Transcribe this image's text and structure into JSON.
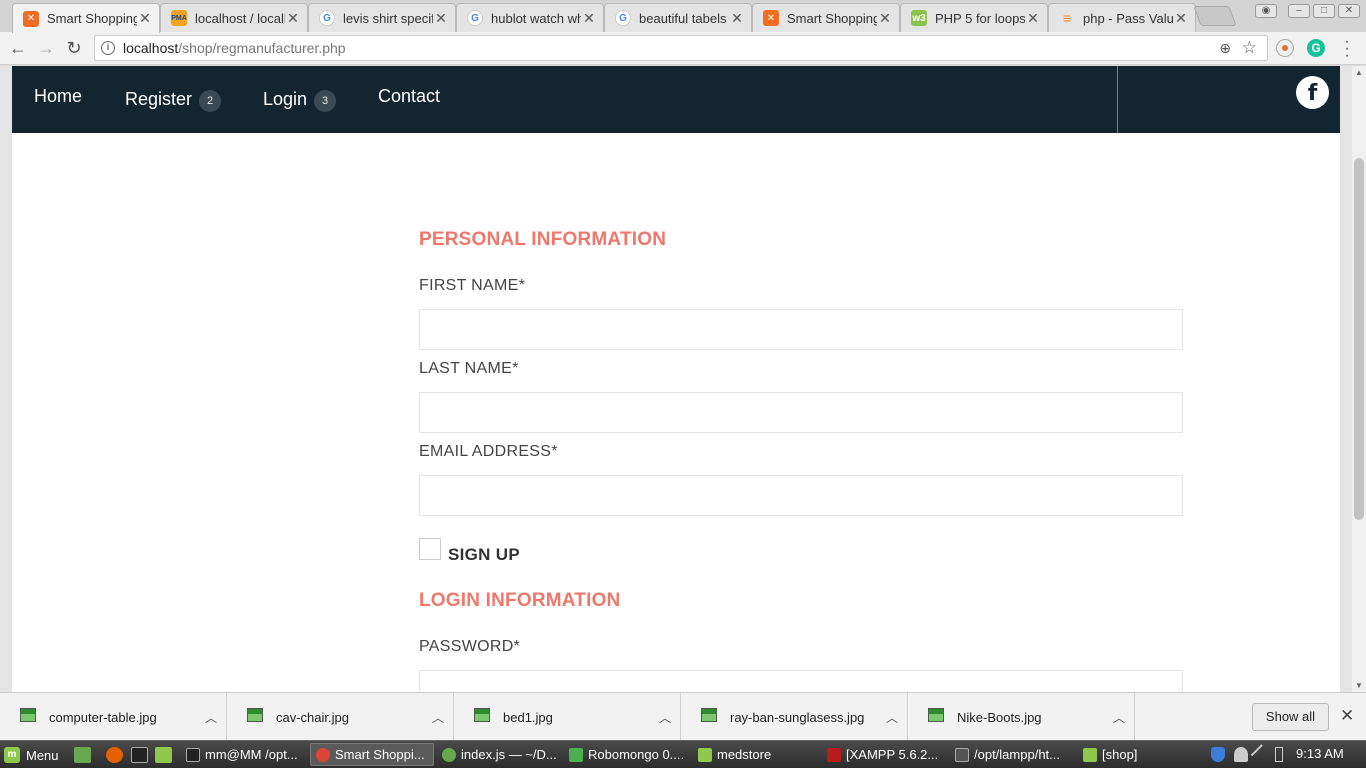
{
  "browser": {
    "tabs": [
      {
        "title": "Smart Shopping",
        "icon": "xampp-icon",
        "active": true
      },
      {
        "title": "localhost / localhost",
        "icon": "phpmyadmin-icon"
      },
      {
        "title": "levis shirt specifications",
        "icon": "google-icon"
      },
      {
        "title": "hublot watch white",
        "icon": "google-icon"
      },
      {
        "title": "beautiful tabels",
        "icon": "google-icon"
      },
      {
        "title": "Smart Shopping",
        "icon": "xampp-icon"
      },
      {
        "title": "PHP 5 for loops",
        "icon": "w3schools-icon"
      },
      {
        "title": "php - Pass Value",
        "icon": "stackoverflow-icon"
      }
    ],
    "url_host": "localhost",
    "url_path": "/shop/regmanufacturer.php"
  },
  "site": {
    "nav": [
      {
        "label": "Home"
      },
      {
        "label": "Register",
        "badge": "2"
      },
      {
        "label": "Login",
        "badge": "3"
      },
      {
        "label": "Contact"
      }
    ],
    "facebook_glyph": "f"
  },
  "form": {
    "personal_title": "PERSONAL INFORMATION",
    "first_name_label": "FIRST NAME*",
    "first_name_value": "",
    "last_name_label": "LAST NAME*",
    "last_name_value": "",
    "email_label": "EMAIL ADDRESS*",
    "email_value": "",
    "signup_label": "SIGN UP",
    "signup_checked": false,
    "login_title": "LOGIN INFORMATION",
    "password_label": "PASSWORD*"
  },
  "downloads": {
    "items": [
      "computer-table.jpg",
      "cav-chair.jpg",
      "bed1.jpg",
      "ray-ban-sunglasess.jpg",
      "Nike-Boots.jpg"
    ],
    "show_all": "Show all"
  },
  "taskbar": {
    "menu_label": "Menu",
    "tasks": [
      {
        "title": "mm@MM /opt..."
      },
      {
        "title": "Smart Shoppi...",
        "active": true
      },
      {
        "title": "index.js — ~/D..."
      },
      {
        "title": "Robomongo 0...."
      },
      {
        "title": "medstore"
      },
      {
        "title": "[XAMPP 5.6.2..."
      },
      {
        "title": "/opt/lampp/ht..."
      },
      {
        "title": "[shop]"
      }
    ],
    "clock": "9:13 AM"
  },
  "colors": {
    "nav_bg": "#132530",
    "section_title": "#f0776b"
  }
}
